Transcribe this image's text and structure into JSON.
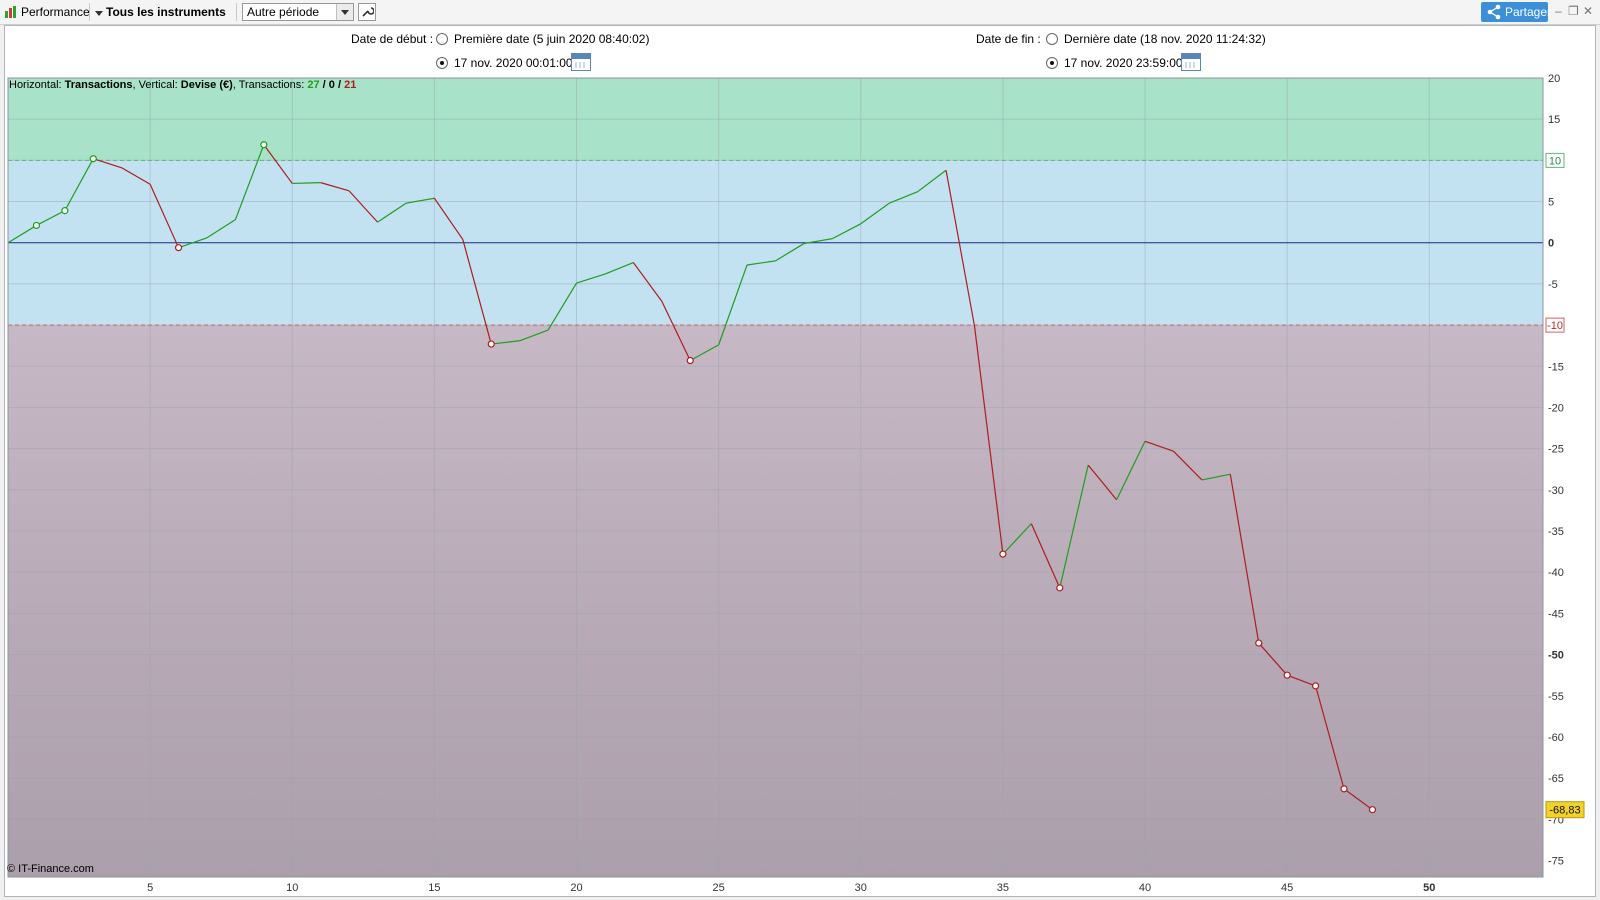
{
  "toolbar": {
    "performance_label": "Performance",
    "instruments_label": "Tous les instruments",
    "period_value": "Autre période",
    "share_label": "Partager",
    "min_icon": "minimize-icon",
    "restore_icon": "restore-icon",
    "close_icon": "close-icon"
  },
  "dates": {
    "start_label": "Date de début :",
    "start_option_first": "Première date (5 juin 2020 08:40:02)",
    "start_option_custom": "17 nov. 2020 00:01:00",
    "start_selected": "custom",
    "end_label": "Date de fin :",
    "end_option_last": "Dernière date (18 nov. 2020 11:24:32)",
    "end_option_custom": "17 nov. 2020 23:59:00",
    "end_selected": "custom"
  },
  "chart_info": {
    "h_prefix": "Horizontal: ",
    "h_value": "Transactions",
    "v_prefix": ", Vertical: ",
    "v_value": "Devise (€)",
    "t_prefix": ", Transactions: ",
    "t_win": "27",
    "t_sep1": " / ",
    "t_zero": "0",
    "t_sep2": " / ",
    "t_loss": "21"
  },
  "footer": {
    "copyright": "© IT-Finance.com"
  },
  "colors": {
    "up": "#1e9e1e",
    "down": "#b01c1c",
    "zone_high": "#a8e2c9",
    "zone_mid": "#c2e2f1",
    "zone_low_top": "#c6b8c4",
    "zone_low_bottom": "#ab9fab",
    "zero_line": "#1f2f8c",
    "current_badge": "#f2d229"
  },
  "chart_data": {
    "type": "line",
    "x": [
      0,
      1,
      2,
      3,
      4,
      5,
      6,
      7,
      8,
      9,
      10,
      11,
      12,
      13,
      14,
      15,
      16,
      17,
      18,
      19,
      20,
      21,
      22,
      23,
      24,
      25,
      26,
      27,
      28,
      29,
      30,
      31,
      32,
      33,
      34,
      35,
      36,
      37,
      38,
      39,
      40,
      41,
      42,
      43,
      44,
      45,
      46,
      47,
      48
    ],
    "y": [
      0,
      2.1,
      3.9,
      10.2,
      9.1,
      7.1,
      -0.6,
      0.6,
      2.8,
      11.9,
      7.2,
      7.3,
      6.3,
      2.5,
      4.8,
      5.4,
      0.4,
      -12.3,
      -11.9,
      -10.6,
      -4.9,
      -3.8,
      -2.4,
      -7.1,
      -14.3,
      -12.4,
      -2.7,
      -2.2,
      -0.1,
      0.5,
      2.3,
      4.8,
      6.2,
      8.8,
      -10.1,
      -37.8,
      -34.1,
      -41.9,
      -27.0,
      -31.2,
      -24.1,
      -25.3,
      -28.8,
      -28.1,
      -48.6,
      -52.5,
      -53.8,
      -66.3,
      -68.83
    ],
    "markers": [
      1,
      2,
      3,
      6,
      9,
      17,
      24,
      35,
      37,
      44,
      45,
      46,
      47,
      48
    ],
    "xlim": [
      0,
      54
    ],
    "ylim": [
      -77,
      20
    ],
    "xticks": [
      5,
      10,
      15,
      20,
      25,
      30,
      35,
      40,
      45,
      50
    ],
    "yticks": [
      20,
      15,
      10,
      5,
      0,
      -5,
      -10,
      -15,
      -20,
      -25,
      -30,
      -35,
      -40,
      -45,
      -50,
      -55,
      -60,
      -65,
      -70,
      -75
    ],
    "upper_threshold": 10,
    "lower_threshold": -10,
    "upper_threshold_label": "10",
    "lower_threshold_label": "-10",
    "current_value_label": "-68,83",
    "grid": true
  }
}
